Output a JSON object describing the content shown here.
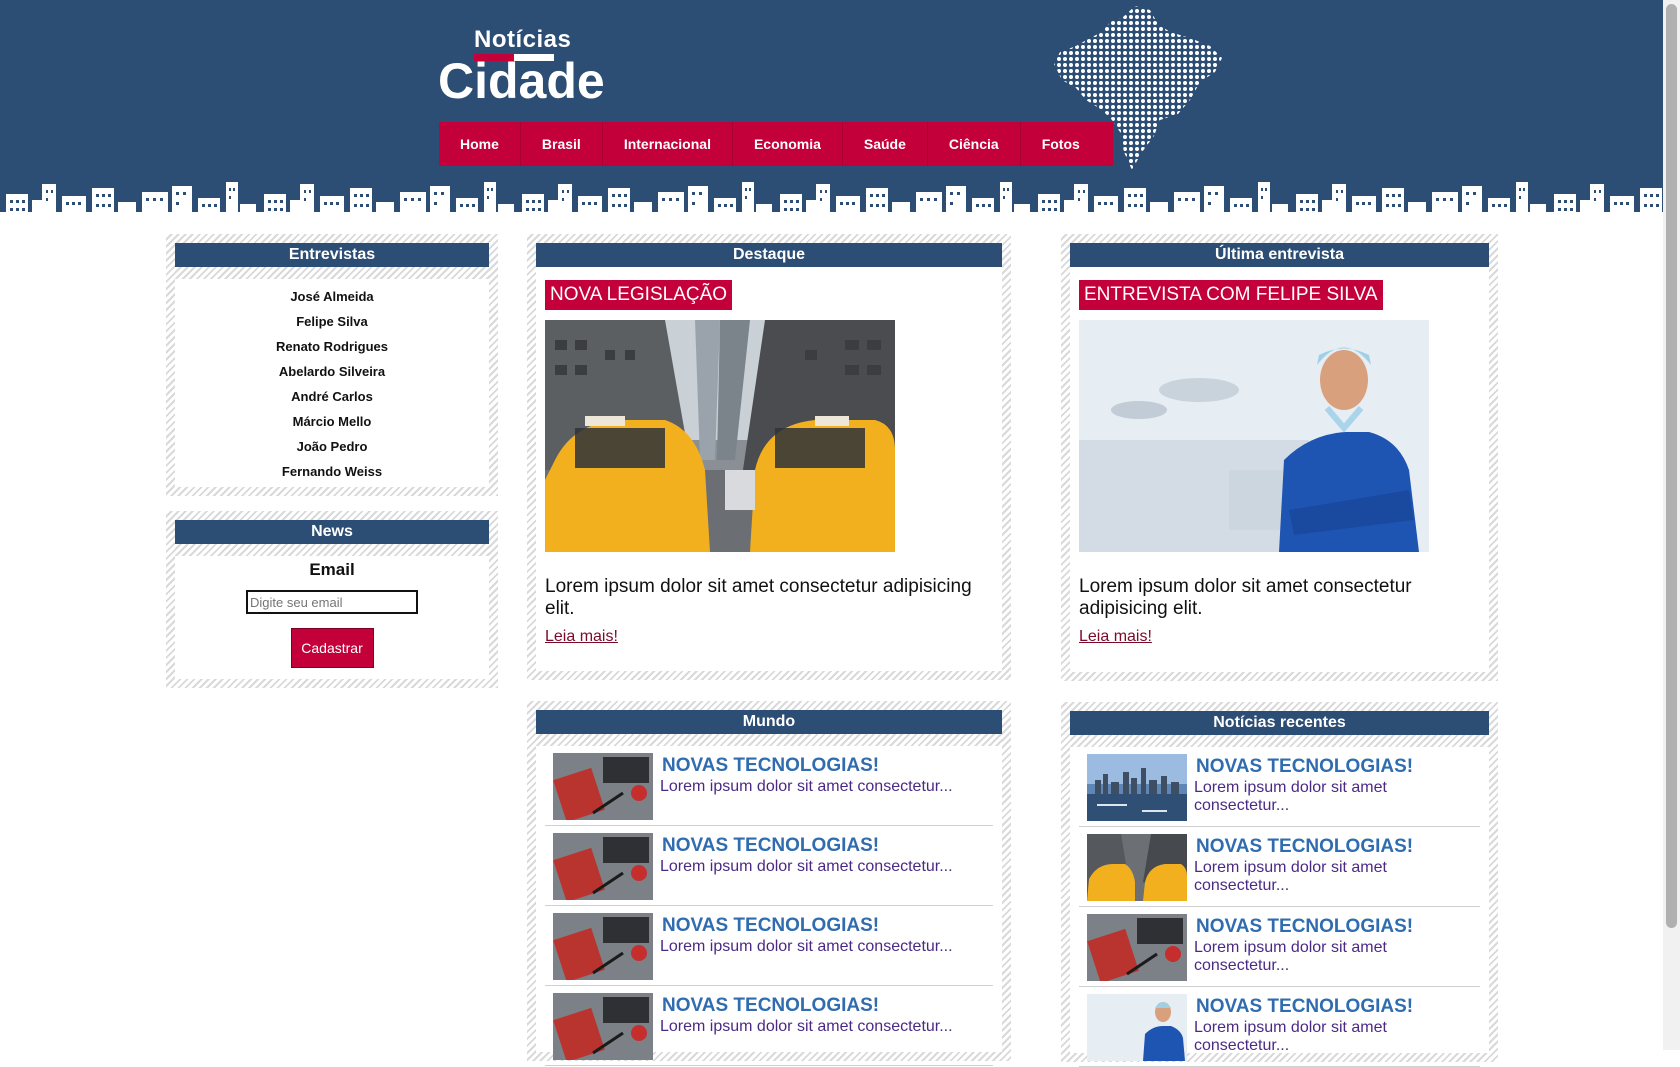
{
  "logo": {
    "top": "Notícias",
    "main": "Cidade"
  },
  "nav": [
    "Home",
    "Brasil",
    "Internacional",
    "Economia",
    "Saúde",
    "Ciência",
    "Fotos"
  ],
  "entrevistas": {
    "title": "Entrevistas",
    "names": [
      "José Almeida",
      "Felipe Silva",
      "Renato Rodrigues",
      "Abelardo Silveira",
      "André Carlos",
      "Márcio Mello",
      "João Pedro",
      "Fernando Weiss"
    ]
  },
  "news": {
    "title": "News",
    "email_label": "Email",
    "email_placeholder": "Digite seu email",
    "button": "Cadastrar"
  },
  "destaque": {
    "title": "Destaque",
    "tag": "NOVA LEGISLAÇÃO",
    "text": "Lorem ipsum dolor sit amet consectetur adipisicing elit.",
    "link": "Leia mais!"
  },
  "ultima": {
    "title": "Última entrevista",
    "tag": "ENTREVISTA COM FELIPE SILVA",
    "text": "Lorem ipsum dolor sit amet consectetur adipisicing elit.",
    "link": "Leia mais!"
  },
  "mundo": {
    "title": "Mundo",
    "items": [
      {
        "title": "NOVAS TECNOLOGIAS!",
        "text": "Lorem ipsum dolor sit amet consectetur..."
      },
      {
        "title": "NOVAS TECNOLOGIAS!",
        "text": "Lorem ipsum dolor sit amet consectetur..."
      },
      {
        "title": "NOVAS TECNOLOGIAS!",
        "text": "Lorem ipsum dolor sit amet consectetur..."
      },
      {
        "title": "NOVAS TECNOLOGIAS!",
        "text": "Lorem ipsum dolor sit amet consectetur..."
      }
    ]
  },
  "recentes": {
    "title": "Notícias recentes",
    "items": [
      {
        "title": "NOVAS TECNOLOGIAS!",
        "text": "Lorem ipsum dolor sit amet consectetur..."
      },
      {
        "title": "NOVAS TECNOLOGIAS!",
        "text": "Lorem ipsum dolor sit amet consectetur..."
      },
      {
        "title": "NOVAS TECNOLOGIAS!",
        "text": "Lorem ipsum dolor sit amet consectetur..."
      },
      {
        "title": "NOVAS TECNOLOGIAS!",
        "text": "Lorem ipsum dolor sit amet consectetur..."
      }
    ]
  },
  "colors": {
    "header": "#2c4d74",
    "accent": "#c4003a",
    "link_title": "#2f6db0",
    "item_text": "#4b2a84"
  },
  "icons": [
    "brazil-map-dots-icon",
    "city-skyline-icon"
  ]
}
